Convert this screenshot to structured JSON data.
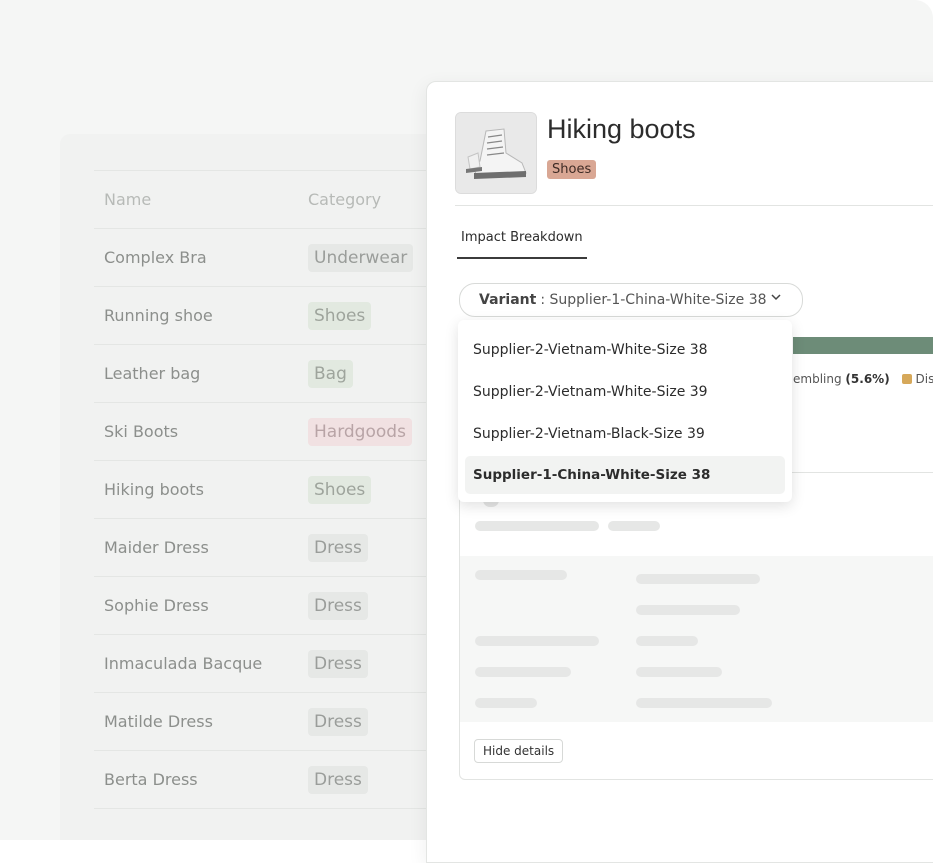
{
  "table": {
    "headers": {
      "name": "Name",
      "category": "Category"
    },
    "rows": [
      {
        "name": "Complex Bra",
        "category": "Underwear"
      },
      {
        "name": "Running shoe",
        "category": "Shoes"
      },
      {
        "name": "Leather bag",
        "category": "Bag"
      },
      {
        "name": "Ski Boots",
        "category": "Hardgoods"
      },
      {
        "name": "Hiking boots",
        "category": "Shoes"
      },
      {
        "name": "Maider Dress",
        "category": "Dress"
      },
      {
        "name": "Sophie Dress",
        "category": "Dress"
      },
      {
        "name": "Inmaculada Bacque",
        "category": "Dress"
      },
      {
        "name": "Matilde Dress",
        "category": "Dress"
      },
      {
        "name": "Berta Dress",
        "category": "Dress"
      }
    ]
  },
  "product": {
    "title": "Hiking boots",
    "category_badge": "Shoes",
    "tab": "Impact Breakdown",
    "variant_label": "Variant",
    "variant_value": ": Supplier-1-China-White-Size 38",
    "legend_text": "embling",
    "legend_pct": "(5.6%)",
    "legend_next": "Distri",
    "hide_details": "Hide details"
  },
  "menu": {
    "items": [
      "Supplier-2-Vietnam-White-Size 38",
      "Supplier-2-Vietnam-White-Size 39",
      "Supplier-2-Vietnam-Black-Size 39",
      "Supplier-1-China-White-Size 38"
    ],
    "selected_index": 3
  },
  "colors": {
    "badge_shoes": "#d9a794",
    "bar": "#6d8c78",
    "legend_swatch": "#d6a85a"
  }
}
